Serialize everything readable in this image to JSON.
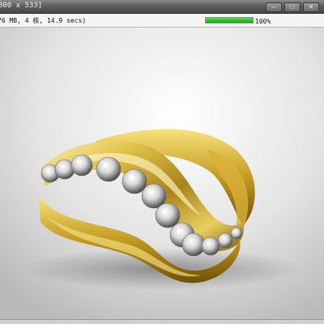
{
  "window": {
    "title": "800 x 533]",
    "controls": [
      "–",
      "□",
      "✕"
    ]
  },
  "status": {
    "info": "76 MB, 4 核, 14.9 secs)",
    "progress_percent": 100,
    "progress_label": "100%"
  },
  "colors": {
    "titlebar": "#5e5e5e",
    "progress": "#22c022",
    "gold": "#c9a832",
    "backdrop": "#e6e6e6"
  },
  "icons": [
    "minimize-icon",
    "maximize-icon",
    "close-icon"
  ]
}
